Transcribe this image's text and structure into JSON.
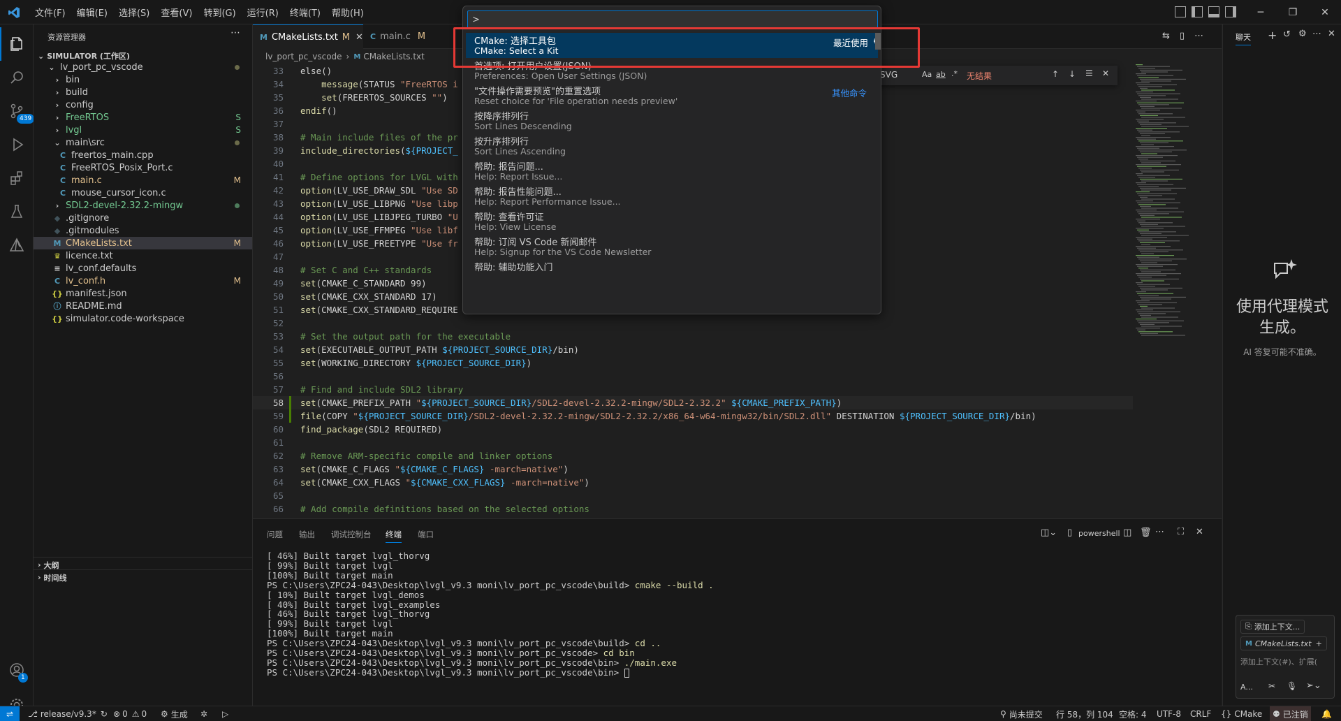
{
  "menu": [
    "文件(F)",
    "编辑(E)",
    "选择(S)",
    "查看(V)",
    "转到(G)",
    "运行(R)",
    "终端(T)",
    "帮助(H)"
  ],
  "activity": {
    "scm_badge": "439",
    "account_badge": "1"
  },
  "sidebar": {
    "title": "资源管理器",
    "workspace": "SIMULATOR (工作区)",
    "items": [
      {
        "label": "lv_port_pc_vscode",
        "type": "folder-open",
        "level": 0,
        "status": "dot"
      },
      {
        "label": "bin",
        "type": "folder",
        "level": 1,
        "status": ""
      },
      {
        "label": "build",
        "type": "folder",
        "level": 1,
        "status": ""
      },
      {
        "label": "config",
        "type": "folder",
        "level": 1,
        "status": ""
      },
      {
        "label": "FreeRTOS",
        "type": "folder",
        "level": 1,
        "status": "S"
      },
      {
        "label": "lvgl",
        "type": "folder",
        "level": 1,
        "status": "S"
      },
      {
        "label": "main\\src",
        "type": "folder-open",
        "level": 1,
        "status": "dot"
      },
      {
        "label": "freertos_main.cpp",
        "type": "cpp",
        "level": 2,
        "status": ""
      },
      {
        "label": "FreeRTOS_Posix_Port.c",
        "type": "c",
        "level": 2,
        "status": ""
      },
      {
        "label": "main.c",
        "type": "c",
        "level": 2,
        "status": "M"
      },
      {
        "label": "mouse_cursor_icon.c",
        "type": "c",
        "level": 2,
        "status": ""
      },
      {
        "label": "SDL2-devel-2.32.2-mingw",
        "type": "folder",
        "level": 1,
        "status": "dot-green"
      },
      {
        "label": ".gitignore",
        "type": "git",
        "level": 1,
        "status": ""
      },
      {
        "label": ".gitmodules",
        "type": "git",
        "level": 1,
        "status": ""
      },
      {
        "label": "CMakeLists.txt",
        "type": "cmake",
        "level": 1,
        "status": "M"
      },
      {
        "label": "licence.txt",
        "type": "lic",
        "level": 1,
        "status": ""
      },
      {
        "label": "lv_conf.defaults",
        "type": "txt",
        "level": 1,
        "status": ""
      },
      {
        "label": "lv_conf.h",
        "type": "c",
        "level": 1,
        "status": "M"
      },
      {
        "label": "manifest.json",
        "type": "json",
        "level": 1,
        "status": ""
      },
      {
        "label": "README.md",
        "type": "info",
        "level": 1,
        "status": ""
      },
      {
        "label": "simulator.code-workspace",
        "type": "json",
        "level": 1,
        "status": ""
      }
    ],
    "outline": "大纲",
    "timeline": "时间线"
  },
  "tabs": [
    {
      "label": "CMakeLists.txt",
      "mod": "M",
      "icon": "M"
    },
    {
      "label": "main.c",
      "mod": "M",
      "icon": "C"
    }
  ],
  "breadcrumb": {
    "folder": "lv_port_pc_vscode",
    "file": "CMakeLists.txt"
  },
  "code": [
    {
      "n": "33",
      "parts": [
        [
          "p",
          "else"
        ],
        [
          "p",
          "()"
        ]
      ]
    },
    {
      "n": "34",
      "parts": [
        [
          "p",
          "    "
        ],
        [
          "f",
          "message"
        ],
        [
          "p",
          "(STATUS "
        ],
        [
          "s",
          "\"FreeRTOS i"
        ]
      ]
    },
    {
      "n": "35",
      "parts": [
        [
          "p",
          "    "
        ],
        [
          "f",
          "set"
        ],
        [
          "p",
          "(FREERTOS_SOURCES "
        ],
        [
          "s",
          "\"\""
        ],
        [
          "p",
          ")"
        ]
      ]
    },
    {
      "n": "36",
      "parts": [
        [
          "f",
          "endif"
        ],
        [
          "p",
          "()"
        ]
      ]
    },
    {
      "n": "37",
      "parts": []
    },
    {
      "n": "38",
      "parts": [
        [
          "c",
          "# Main include files of the pr"
        ]
      ]
    },
    {
      "n": "39",
      "parts": [
        [
          "f",
          "include_directories"
        ],
        [
          "p",
          "("
        ],
        [
          "v",
          "${PROJECT_"
        ]
      ]
    },
    {
      "n": "40",
      "parts": []
    },
    {
      "n": "41",
      "parts": [
        [
          "c",
          "# Define options for LVGL with"
        ]
      ]
    },
    {
      "n": "42",
      "parts": [
        [
          "f",
          "option"
        ],
        [
          "p",
          "(LV_USE_DRAW_SDL "
        ],
        [
          "s",
          "\"Use SD"
        ]
      ]
    },
    {
      "n": "43",
      "parts": [
        [
          "f",
          "option"
        ],
        [
          "p",
          "(LV_USE_LIBPNG "
        ],
        [
          "s",
          "\"Use libp"
        ]
      ]
    },
    {
      "n": "44",
      "parts": [
        [
          "f",
          "option"
        ],
        [
          "p",
          "(LV_USE_LIBJPEG_TURBO "
        ],
        [
          "s",
          "\"U"
        ]
      ]
    },
    {
      "n": "45",
      "parts": [
        [
          "f",
          "option"
        ],
        [
          "p",
          "(LV_USE_FFMPEG "
        ],
        [
          "s",
          "\"Use libf"
        ]
      ]
    },
    {
      "n": "46",
      "parts": [
        [
          "f",
          "option"
        ],
        [
          "p",
          "(LV_USE_FREETYPE "
        ],
        [
          "s",
          "\"Use fr"
        ]
      ]
    },
    {
      "n": "47",
      "parts": []
    },
    {
      "n": "48",
      "parts": [
        [
          "c",
          "# Set C and C++ standards"
        ]
      ]
    },
    {
      "n": "49",
      "parts": [
        [
          "f",
          "set"
        ],
        [
          "p",
          "(CMAKE_C_STANDARD 99)"
        ]
      ]
    },
    {
      "n": "50",
      "parts": [
        [
          "f",
          "set"
        ],
        [
          "p",
          "(CMAKE_CXX_STANDARD 17)"
        ]
      ]
    },
    {
      "n": "51",
      "parts": [
        [
          "f",
          "set"
        ],
        [
          "p",
          "(CMAKE_CXX_STANDARD_REQUIRE"
        ]
      ]
    },
    {
      "n": "52",
      "parts": []
    },
    {
      "n": "53",
      "parts": [
        [
          "c",
          "# Set the output path for the executable"
        ]
      ]
    },
    {
      "n": "54",
      "parts": [
        [
          "f",
          "set"
        ],
        [
          "p",
          "(EXECUTABLE_OUTPUT_PATH "
        ],
        [
          "v",
          "${PROJECT_SOURCE_DIR}"
        ],
        [
          "p",
          "/bin)"
        ]
      ]
    },
    {
      "n": "55",
      "parts": [
        [
          "f",
          "set"
        ],
        [
          "p",
          "(WORKING_DIRECTORY "
        ],
        [
          "v",
          "${PROJECT_SOURCE_DIR}"
        ],
        [
          "p",
          ")"
        ]
      ]
    },
    {
      "n": "56",
      "parts": []
    },
    {
      "n": "57",
      "parts": [
        [
          "c",
          "# Find and include SDL2 library"
        ]
      ]
    },
    {
      "n": "58",
      "parts": [
        [
          "f",
          "set"
        ],
        [
          "p",
          "(CMAKE_PREFIX_PATH "
        ],
        [
          "s",
          "\""
        ],
        [
          "v",
          "${PROJECT_SOURCE_DIR}"
        ],
        [
          "s",
          "/SDL2-devel-2.32.2-mingw/SDL2-2.32.2\""
        ],
        [
          "p",
          " "
        ],
        [
          "v",
          "${CMAKE_PREFIX_PATH}"
        ],
        [
          "p",
          ")"
        ]
      ]
    },
    {
      "n": "59",
      "parts": [
        [
          "f",
          "file"
        ],
        [
          "p",
          "(COPY "
        ],
        [
          "s",
          "\""
        ],
        [
          "v",
          "${PROJECT_SOURCE_DIR}"
        ],
        [
          "s",
          "/SDL2-devel-2.32.2-mingw/SDL2-2.32.2/x86_64-w64-mingw32/bin/SDL2.dll\""
        ],
        [
          "p",
          " DESTINATION "
        ],
        [
          "v",
          "${PROJECT_SOURCE_DIR}"
        ],
        [
          "p",
          "/bin)"
        ]
      ]
    },
    {
      "n": "60",
      "parts": [
        [
          "f",
          "find_package"
        ],
        [
          "p",
          "(SDL2 REQUIRED)"
        ]
      ]
    },
    {
      "n": "61",
      "parts": []
    },
    {
      "n": "62",
      "parts": [
        [
          "c",
          "# Remove ARM-specific compile and linker options"
        ]
      ]
    },
    {
      "n": "63",
      "parts": [
        [
          "f",
          "set"
        ],
        [
          "p",
          "(CMAKE_C_FLAGS "
        ],
        [
          "s",
          "\""
        ],
        [
          "v",
          "${CMAKE_C_FLAGS}"
        ],
        [
          "s",
          " -march=native\""
        ],
        [
          "p",
          ")"
        ]
      ]
    },
    {
      "n": "64",
      "parts": [
        [
          "f",
          "set"
        ],
        [
          "p",
          "(CMAKE_CXX_FLAGS "
        ],
        [
          "s",
          "\""
        ],
        [
          "v",
          "${CMAKE_CXX_FLAGS}"
        ],
        [
          "s",
          " -march=native\""
        ],
        [
          "p",
          ")"
        ]
      ]
    },
    {
      "n": "65",
      "parts": []
    },
    {
      "n": "66",
      "parts": [
        [
          "c",
          "# Add compile definitions based on the selected options"
        ]
      ]
    }
  ],
  "find_widget": {
    "query": "SVG",
    "case": "Aa",
    "word": "ab",
    "regex": ".*",
    "result": "无结果"
  },
  "panel": {
    "tabs": [
      "问题",
      "输出",
      "调试控制台",
      "终端",
      "端口"
    ],
    "shell": "powershell",
    "lines": [
      "[ 46%] Built target lvgl_thorvg",
      "[ 99%] Built target lvgl",
      "[100%] Built target main",
      "PS C:\\Users\\ZPC24-043\\Desktop\\lvgl_v9.3 moni\\lv_port_pc_vscode\\build> ",
      "[ 10%] Built target lvgl_demos",
      "[ 40%] Built target lvgl_examples",
      "[ 46%] Built target lvgl_thorvg",
      "[ 99%] Built target lvgl",
      "[100%] Built target main",
      "PS C:\\Users\\ZPC24-043\\Desktop\\lvgl_v9.3 moni\\lv_port_pc_vscode\\build> ",
      "PS C:\\Users\\ZPC24-043\\Desktop\\lvgl_v9.3 moni\\lv_port_pc_vscode> ",
      "PS C:\\Users\\ZPC24-043\\Desktop\\lvgl_v9.3 moni\\lv_port_pc_vscode\\bin> ",
      "PS C:\\Users\\ZPC24-043\\Desktop\\lvgl_v9.3 moni\\lv_port_pc_vscode\\bin> "
    ],
    "cmds": [
      "",
      "",
      "",
      "cmake --build .",
      "",
      "",
      "",
      "",
      "",
      "cd ..",
      "cd bin",
      "./main.exe",
      ""
    ]
  },
  "palette": {
    "input": ">",
    "items": [
      {
        "zh": "CMake: 选择工具包",
        "en": "CMake: Select a Kit",
        "tag": "最近使用"
      },
      {
        "zh": "首选项: 打开用户设置(JSON)",
        "en": "Preferences: Open User Settings (JSON)",
        "tag": ""
      },
      {
        "zh": "\"文件操作需要预览\"的重置选项",
        "en": "Reset choice for 'File operation needs preview'",
        "tag": "其他命令"
      },
      {
        "zh": "按降序排列行",
        "en": "Sort Lines Descending",
        "tag": ""
      },
      {
        "zh": "按升序排列行",
        "en": "Sort Lines Ascending",
        "tag": ""
      },
      {
        "zh": "帮助: 报告问题...",
        "en": "Help: Report Issue...",
        "tag": ""
      },
      {
        "zh": "帮助: 报告性能问题...",
        "en": "Help: Report Performance Issue...",
        "tag": ""
      },
      {
        "zh": "帮助: 查看许可证",
        "en": "Help: View License",
        "tag": ""
      },
      {
        "zh": "帮助: 订阅 VS Code 新闻邮件",
        "en": "Help: Signup for the VS Code Newsletter",
        "tag": ""
      },
      {
        "zh": "帮助: 辅助功能入门",
        "en": "",
        "tag": ""
      }
    ]
  },
  "chat": {
    "tab": "聊天",
    "heading": "使用代理模式生成。",
    "note": "AI 答复可能不准确。",
    "add_context": "添加上下文...",
    "file": "CMakeLists.txt",
    "placeholder": "添加上下文(#)、扩展(",
    "mode": "A..."
  },
  "status": {
    "branch": "release/v9.3*",
    "errors": "0",
    "warnings": "0",
    "build": "生成",
    "uncommitted": "尚未提交",
    "position": "行 58，列 104",
    "spaces": "空格: 4",
    "encoding": "UTF-8",
    "eol": "CRLF",
    "lang": "CMake",
    "copilot": "已注销"
  },
  "colors": {
    "accent": "#0078d4",
    "highlight_box": "#e53935",
    "selected": "#04395e"
  }
}
